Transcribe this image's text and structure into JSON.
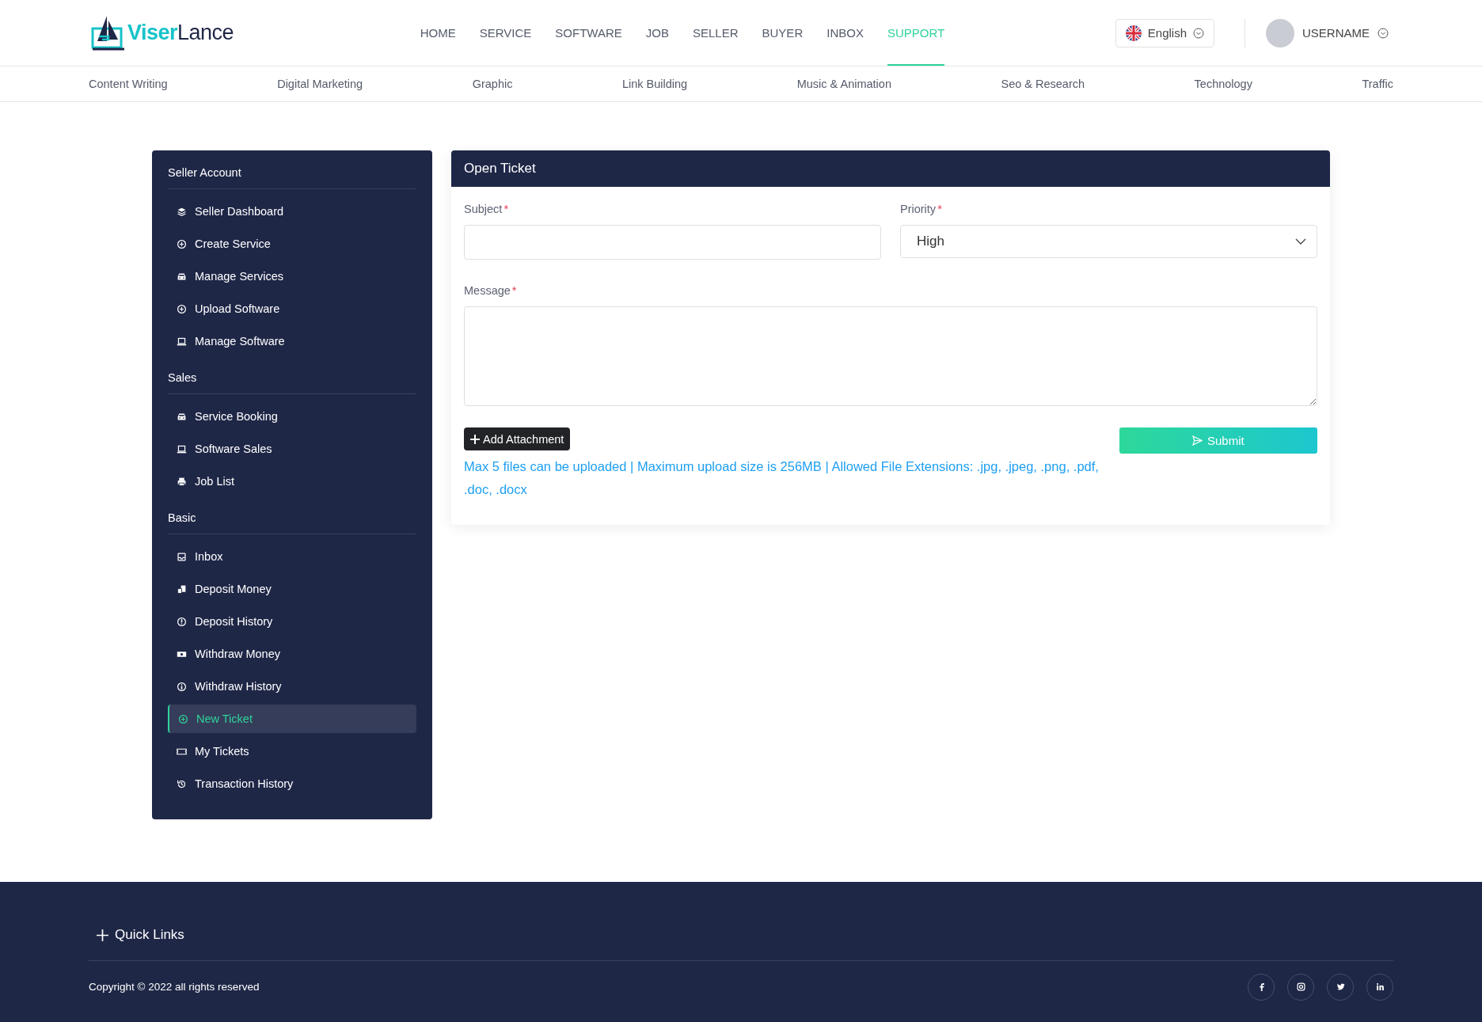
{
  "logo": {
    "part_a": "Viser",
    "part_b": "Lance"
  },
  "nav": [
    {
      "label": "HOME",
      "selected": false
    },
    {
      "label": "SERVICE",
      "selected": false
    },
    {
      "label": "SOFTWARE",
      "selected": false
    },
    {
      "label": "JOB",
      "selected": false
    },
    {
      "label": "SELLER",
      "selected": false
    },
    {
      "label": "BUYER",
      "selected": false
    },
    {
      "label": "INBOX",
      "selected": false
    },
    {
      "label": "SUPPORT",
      "selected": true
    }
  ],
  "language": {
    "label": "English"
  },
  "user": {
    "name": "USERNAME"
  },
  "categories": [
    "Content Writing",
    "Digital Marketing",
    "Graphic",
    "Link Building",
    "Music & Animation",
    "Seo & Research",
    "Technology",
    "Traffic"
  ],
  "sidebar": {
    "sections": [
      {
        "title": "Seller Account",
        "items": [
          {
            "label": "Seller Dashboard",
            "kind": "layers",
            "selected": false
          },
          {
            "label": "Create Service",
            "kind": "plus-circle",
            "selected": false
          },
          {
            "label": "Manage Services",
            "kind": "car",
            "selected": false
          },
          {
            "label": "Upload Software",
            "kind": "plus-circle",
            "selected": false
          },
          {
            "label": "Manage Software",
            "kind": "laptop",
            "selected": false
          }
        ]
      },
      {
        "title": "Sales",
        "items": [
          {
            "label": "Service Booking",
            "kind": "car",
            "selected": false
          },
          {
            "label": "Software Sales",
            "kind": "laptop",
            "selected": false
          },
          {
            "label": "Job List",
            "kind": "printer",
            "selected": false
          }
        ]
      },
      {
        "title": "Basic",
        "items": [
          {
            "label": "Inbox",
            "kind": "inbox",
            "selected": false
          },
          {
            "label": "Deposit Money",
            "kind": "coins",
            "selected": false
          },
          {
            "label": "Deposit History",
            "kind": "down-circle",
            "selected": false
          },
          {
            "label": "Withdraw Money",
            "kind": "cash",
            "selected": false
          },
          {
            "label": "Withdraw History",
            "kind": "up-circle",
            "selected": false
          },
          {
            "label": "New Ticket",
            "kind": "plus-circle",
            "selected": true
          },
          {
            "label": "My Tickets",
            "kind": "ticket",
            "selected": false
          },
          {
            "label": "Transaction History",
            "kind": "history",
            "selected": false
          }
        ]
      }
    ]
  },
  "ticket_form": {
    "title": "Open Ticket",
    "fields": [
      {
        "label": "Subject",
        "required_mark": "*",
        "kind": "text"
      },
      {
        "label": "Priority",
        "required_mark": "*",
        "kind": "select",
        "value": "High"
      },
      {
        "label": "Message",
        "required_mark": "*",
        "kind": "textarea"
      }
    ],
    "add_attachment": "Add Attachment",
    "submit": "Submit",
    "note": "Max 5 files can be uploaded | Maximum upload size is 256MB | Allowed File Extensions: .jpg, .jpeg, .png, .pdf, .doc, .docx"
  },
  "footer": {
    "quick_links": "Quick Links",
    "copyright": "Copyright © 2022 all rights reserved",
    "social": [
      {
        "kind": "facebook"
      },
      {
        "kind": "instagram"
      },
      {
        "kind": "twitter"
      },
      {
        "kind": "linkedin"
      }
    ]
  }
}
